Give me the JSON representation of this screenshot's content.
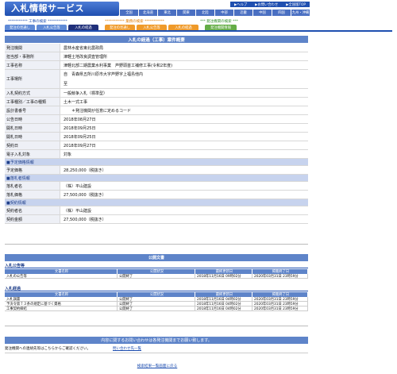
{
  "header": {
    "logo": "入札情報サービス",
    "toplinks": [
      "▶ヘルプ",
      "▶お問い合わせ",
      "▶全国版TOP"
    ],
    "regions": [
      "全国",
      "北海道",
      "東北",
      "関東",
      "北陸",
      "中部",
      "近畿",
      "中国",
      "四国",
      "九州・沖縄"
    ]
  },
  "sections": {
    "construction": "*********** 工事の検索 ***********",
    "service": "*********** 業務の検索 ***********",
    "procurement": "*** 発注機関の検索 ***"
  },
  "tabs": {
    "c1": "発注の見通し",
    "c2": "入札公告等",
    "c3": "入札の経過",
    "s1": "発注の見通し",
    "s2": "入札公告等",
    "s3": "入札の経過",
    "p1": "発注機関情報"
  },
  "main_title": "入札の経過（工事）案件概要",
  "detail": {
    "rows": [
      {
        "label": "発注機関",
        "value": "農林水産省東北農政局"
      },
      {
        "label": "担当部・事務所",
        "value": "津軽土地改良調査管理所"
      },
      {
        "label": "工事名称",
        "value": "津軽北部二期農業水利事業　芦野頭首工補修工事(令和2年度)"
      },
      {
        "label": "工事場所",
        "value": "自　青森県五所川原市大字芦野字上福島他内",
        "value2": "至"
      },
      {
        "label": "入札契約方式",
        "value": "一般競争入札（標準型）"
      },
      {
        "label": "工事種別／工事の種類",
        "value": "土木一式工事"
      },
      {
        "label": "設計書番号",
        "value": "＊発注機関が任意に定めるコード"
      },
      {
        "label": "公告日時",
        "value": "2018年08月27日"
      },
      {
        "label": "開札日時",
        "value": "2018年09月25日"
      },
      {
        "label": "開札日時",
        "value": "2018年09月25日"
      },
      {
        "label": "契約日",
        "value": "2018年09月27日"
      },
      {
        "label": "電子入札対象",
        "value": "対象"
      }
    ],
    "section_planned": "■予定価格情報",
    "planned_label": "予定価格",
    "planned_value": "28,250,000（税抜き）",
    "section_successful": "■落札者情報",
    "bidder_label": "落札者名",
    "bidder_value": "（株）平山建設",
    "price_label": "落札価格",
    "price_value": "27,500,000（税抜き）",
    "section_contract": "■契約情報",
    "contractor_label": "契約者名",
    "contractor_value": "（株）平山建設",
    "amount_label": "契約金額",
    "amount_value": "27,500,000（税抜き）"
  },
  "public_docs": {
    "title": "公開文書",
    "notice_heading": "入札公告等",
    "columns": [
      "文書名称",
      "公開状況",
      "最終更新日",
      "掲載終了日"
    ],
    "notice_rows": [
      [
        "入札の公告等",
        "公開終了",
        "2018年11月16日 09時02分",
        "2020年03月31日 23時59分"
      ]
    ],
    "progress_heading": "入札経過",
    "progress_rows": [
      [
        "入札調書",
        "公開終了",
        "2018年11月16日 04時02分",
        "2020年03月31日 23時59分"
      ],
      [
        "予決令第７３条の規定に基づく資格",
        "公開終了",
        "2018年11月16日 04時02分",
        "2020年03月31日 23時59分"
      ],
      [
        "工事契約締結",
        "公開終了",
        "2018年11月16日 04時02分",
        "2020年03月31日 23時59分"
      ]
    ]
  },
  "contact": {
    "band": "内容に関するお問い合わせは各発注機関までお願い致します。",
    "label": "発注機関への連絡先等はこちらからご確認ください。",
    "link": "問い合わせ先一覧"
  },
  "back_link": "検索結果一覧画面に戻る"
}
